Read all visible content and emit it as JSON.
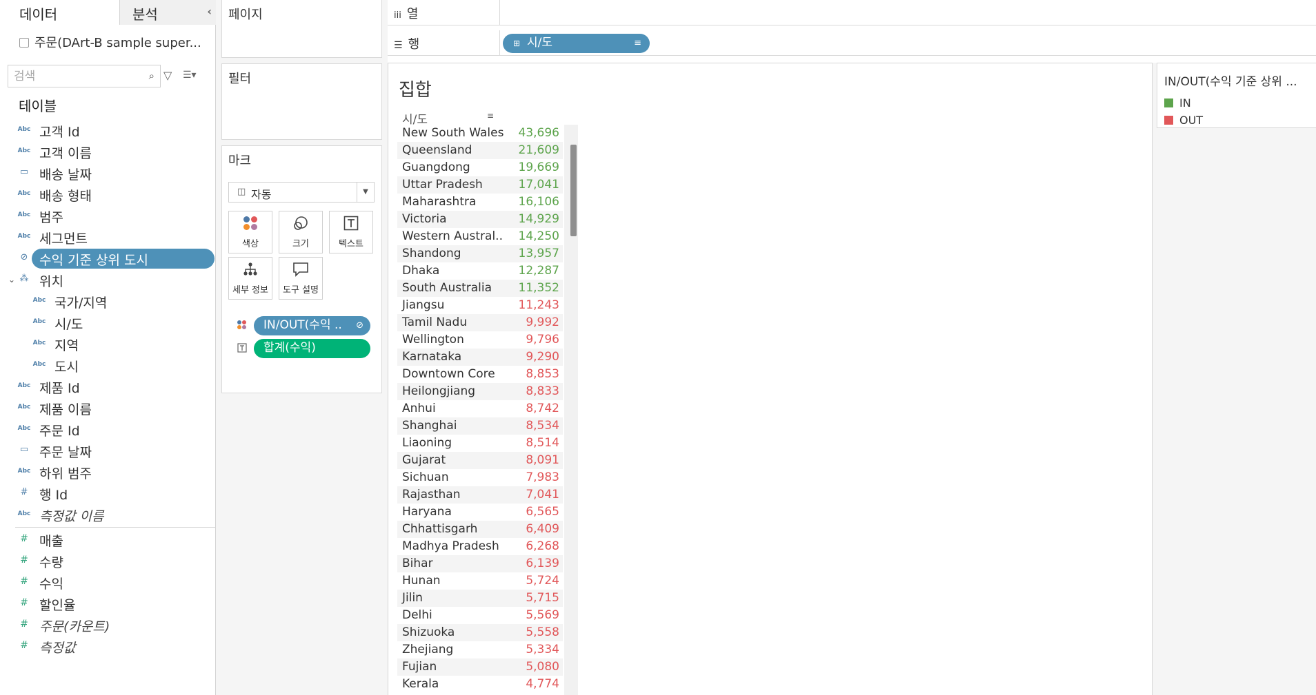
{
  "left_pane": {
    "tab_data": "데이터",
    "tab_analysis": "분석",
    "collapse_glyph": "‹",
    "data_source": "주문(DArt-B sample super...",
    "search_placeholder": "검색",
    "section_title": "테이블",
    "dimensions": [
      {
        "type": "Abc",
        "name": "고객 Id"
      },
      {
        "type": "Abc",
        "name": "고객 이름"
      },
      {
        "type": "date",
        "name": "배송 날짜"
      },
      {
        "type": "Abc",
        "name": "배송 형태"
      },
      {
        "type": "Abc",
        "name": "범주"
      },
      {
        "type": "Abc",
        "name": "세그먼트"
      },
      {
        "type": "set",
        "name": "수익 기준 상위 도시",
        "selected": true
      },
      {
        "type": "hierarchy",
        "name": "위치",
        "expanded": true
      },
      {
        "type": "Abc",
        "name": "국가/지역",
        "indent": true
      },
      {
        "type": "Abc",
        "name": "시/도",
        "indent": true
      },
      {
        "type": "Abc",
        "name": "지역",
        "indent": true
      },
      {
        "type": "Abc",
        "name": "도시",
        "indent": true
      },
      {
        "type": "Abc",
        "name": "제품 Id"
      },
      {
        "type": "Abc",
        "name": "제품 이름"
      },
      {
        "type": "Abc",
        "name": "주문 Id"
      },
      {
        "type": "date",
        "name": "주문 날짜"
      },
      {
        "type": "Abc",
        "name": "하위 범주"
      },
      {
        "type": "#",
        "name": "행 Id"
      },
      {
        "type": "Abc",
        "name": "측정값 이름",
        "italic": true
      }
    ],
    "measures": [
      {
        "name": "매출"
      },
      {
        "name": "수량"
      },
      {
        "name": "수익"
      },
      {
        "name": "할인율"
      },
      {
        "name": "주문(카운트)",
        "italic": true
      },
      {
        "name": "측정값",
        "italic": true
      }
    ]
  },
  "shelves": {
    "pages": "페이지",
    "filters": "필터",
    "marks": "마크",
    "mark_type": "자동",
    "buttons": {
      "color": "색상",
      "size": "크기",
      "text": "텍스트",
      "detail": "세부 정보",
      "tooltip": "도구 설명"
    },
    "mark_pills": {
      "color_field": "IN/OUT(수익 ..",
      "text_field": "합계(수익)"
    },
    "columns": "열",
    "rows": "행",
    "rows_pill": "시/도"
  },
  "colors": {
    "accent_blue": "#4e91b8",
    "measure_green": "#00b377",
    "in_green": "#5da44c",
    "out_red": "#e15759"
  },
  "view": {
    "title": "집합",
    "column_header": "시/도",
    "rows": [
      {
        "name": "New South Wales",
        "value": "43,696",
        "group": "IN"
      },
      {
        "name": "Queensland",
        "value": "21,609",
        "group": "IN"
      },
      {
        "name": "Guangdong",
        "value": "19,669",
        "group": "IN"
      },
      {
        "name": "Uttar Pradesh",
        "value": "17,041",
        "group": "IN"
      },
      {
        "name": "Maharashtra",
        "value": "16,106",
        "group": "IN"
      },
      {
        "name": "Victoria",
        "value": "14,929",
        "group": "IN"
      },
      {
        "name": "Western Austral..",
        "value": "14,250",
        "group": "IN"
      },
      {
        "name": "Shandong",
        "value": "13,957",
        "group": "IN"
      },
      {
        "name": "Dhaka",
        "value": "12,287",
        "group": "IN"
      },
      {
        "name": "South Australia",
        "value": "11,352",
        "group": "IN"
      },
      {
        "name": "Jiangsu",
        "value": "11,243",
        "group": "OUT"
      },
      {
        "name": "Tamil Nadu",
        "value": "9,992",
        "group": "OUT"
      },
      {
        "name": "Wellington",
        "value": "9,796",
        "group": "OUT"
      },
      {
        "name": "Karnataka",
        "value": "9,290",
        "group": "OUT"
      },
      {
        "name": "Downtown Core",
        "value": "8,853",
        "group": "OUT"
      },
      {
        "name": "Heilongjiang",
        "value": "8,833",
        "group": "OUT"
      },
      {
        "name": "Anhui",
        "value": "8,742",
        "group": "OUT"
      },
      {
        "name": "Shanghai",
        "value": "8,534",
        "group": "OUT"
      },
      {
        "name": "Liaoning",
        "value": "8,514",
        "group": "OUT"
      },
      {
        "name": "Gujarat",
        "value": "8,091",
        "group": "OUT"
      },
      {
        "name": "Sichuan",
        "value": "7,983",
        "group": "OUT"
      },
      {
        "name": "Rajasthan",
        "value": "7,041",
        "group": "OUT"
      },
      {
        "name": "Haryana",
        "value": "6,565",
        "group": "OUT"
      },
      {
        "name": "Chhattisgarh",
        "value": "6,409",
        "group": "OUT"
      },
      {
        "name": "Madhya Pradesh",
        "value": "6,268",
        "group": "OUT"
      },
      {
        "name": "Bihar",
        "value": "6,139",
        "group": "OUT"
      },
      {
        "name": "Hunan",
        "value": "5,724",
        "group": "OUT"
      },
      {
        "name": "Jilin",
        "value": "5,715",
        "group": "OUT"
      },
      {
        "name": "Delhi",
        "value": "5,569",
        "group": "OUT"
      },
      {
        "name": "Shizuoka",
        "value": "5,558",
        "group": "OUT"
      },
      {
        "name": "Zhejiang",
        "value": "5,334",
        "group": "OUT"
      },
      {
        "name": "Fujian",
        "value": "5,080",
        "group": "OUT"
      },
      {
        "name": "Kerala",
        "value": "4,774",
        "group": "OUT"
      }
    ]
  },
  "legend": {
    "title": "IN/OUT(수익 기준 상위 ...",
    "items": [
      {
        "label": "IN",
        "color": "#5da44c"
      },
      {
        "label": "OUT",
        "color": "#e15759"
      }
    ]
  }
}
